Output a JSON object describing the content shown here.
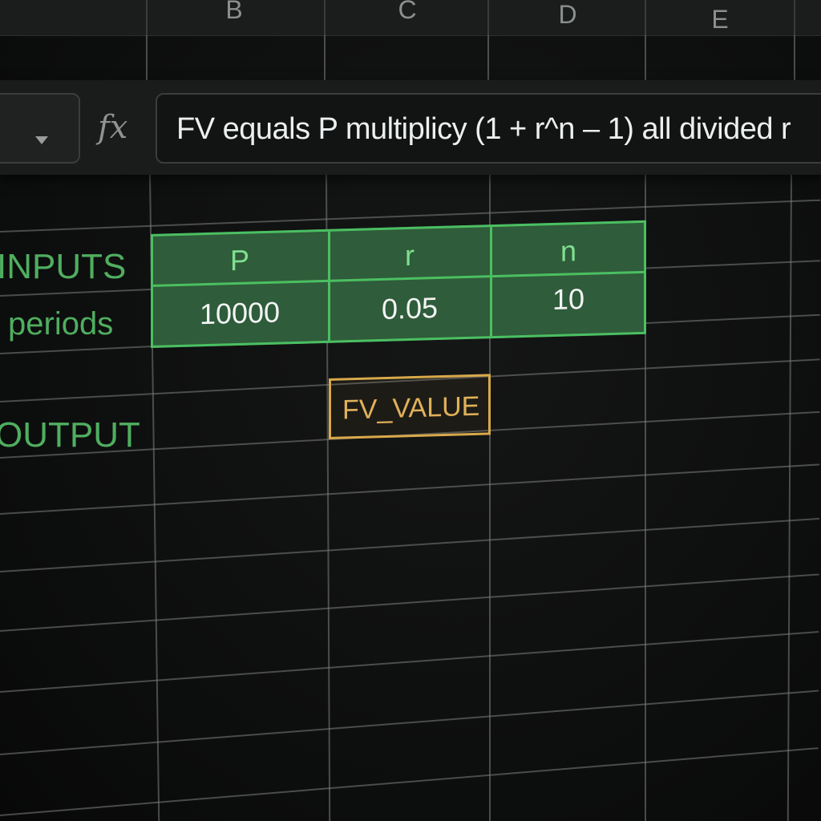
{
  "column_headers": [
    "B",
    "C",
    "D",
    "E"
  ],
  "name_box": {
    "dropdown_icon": "chevron-down-icon"
  },
  "formula_bar": {
    "fx_label": "fx",
    "formula": "FV equals P multiplicy (1 + r^n – 1) all divided r"
  },
  "row_labels": {
    "inputs": "INPUTS",
    "periods": "periods",
    "output": "OUTPUT"
  },
  "input_table": {
    "headers": [
      "P",
      "r",
      "n"
    ],
    "values": [
      "10000",
      "0.05",
      "10"
    ]
  },
  "output_cell": {
    "value": "FV_VALUE"
  },
  "colors": {
    "input_accent": "#4bbf62",
    "input_fill": "#2f5c3a",
    "output_accent": "#d8a94a",
    "background": "#0e0f0f"
  }
}
